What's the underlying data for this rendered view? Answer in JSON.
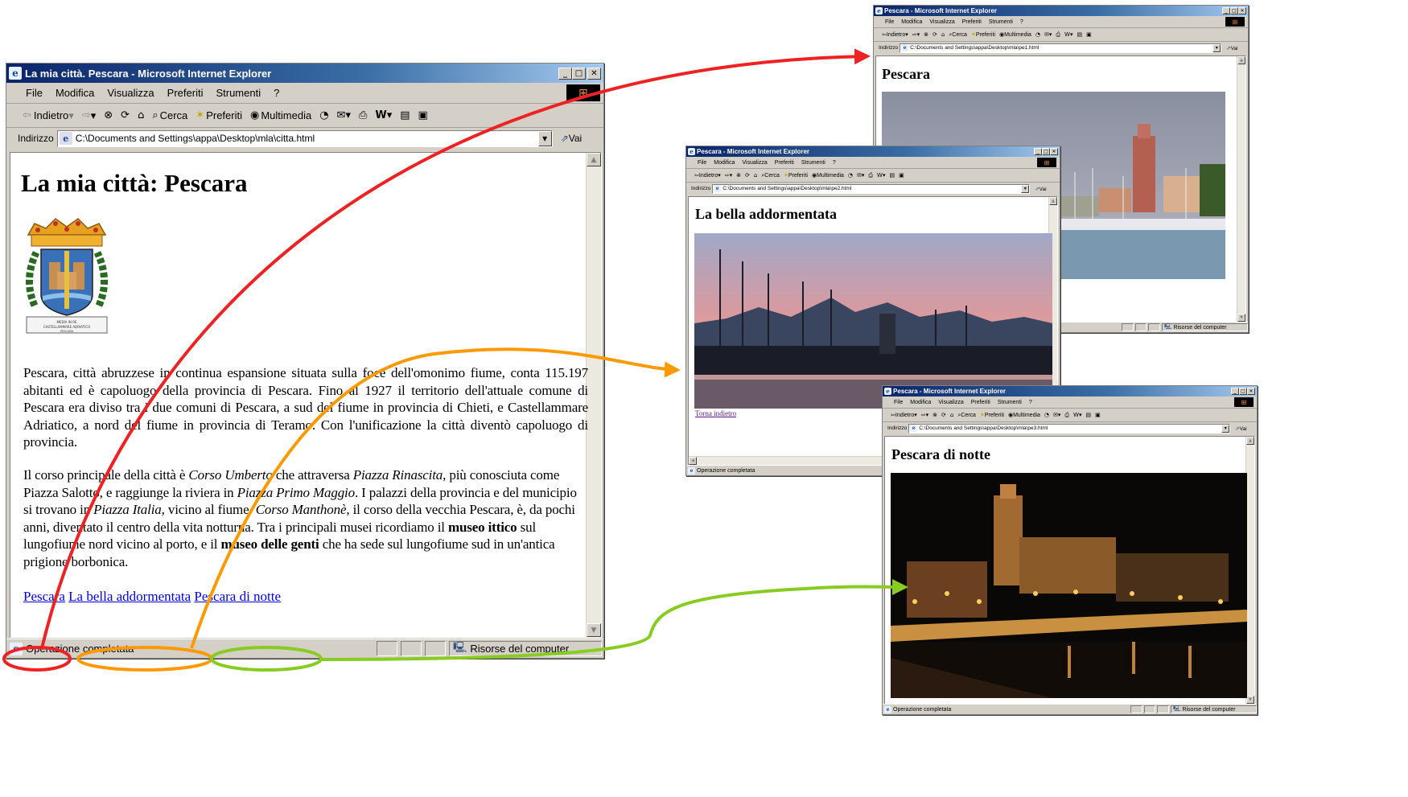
{
  "menu": [
    "File",
    "Modifica",
    "Visualizza",
    "Preferiti",
    "Strumenti",
    "?"
  ],
  "toolbar": {
    "back": "Indietro",
    "search": "Cerca",
    "favorites": "Preferiti",
    "media": "Multimedia"
  },
  "addr_label": "Indirizzo",
  "go_label": "Vai",
  "status_done": "Operazione completata",
  "status_zone": "Risorse del computer",
  "main": {
    "window_title": "La mia città. Pescara - Microsoft Internet Explorer",
    "address": "C:\\Documents and Settings\\appa\\Desktop\\mla\\citta.html",
    "heading": "La mia città: Pescara",
    "p1": "Pescara, città abruzzese in continua espansione situata sulla foce dell'omonimo fiume, conta 115.197 abitanti ed è capoluogo della provincia di Pescara. Fino al 1927 il territorio dell'attuale comune di Pescara era diviso tra i due comuni di Pescara, a sud del fiume in provincia di Chieti, e Castellammare Adriatico, a nord del fiume in provincia di Teramo. Con l'unificazione la città diventò capoluogo di provincia.",
    "p2": {
      "t1": "Il corso principale della città è ",
      "i1": "Corso Umberto",
      "t2": " che attraversa ",
      "i2": "Piazza Rinascita",
      "t3": ", più conosciuta come Piazza Salotto, e raggiunge la riviera in ",
      "i3": "Piazza Primo Maggio",
      "t4": ". I palazzi della provincia e del municipio si trovano in ",
      "i4": "Piazza Italia",
      "t5": ", vicino al fiume. ",
      "i5": "Corso Manthonè",
      "t6": ", il corso della vecchia Pescara, è, da pochi anni, diventato il centro della vita notturna. Tra i principali musei ricordiamo il ",
      "b1": "museo ittico",
      "t7": " sul lungofiume nord vicino al porto, e il ",
      "b2": "museo delle genti",
      "t8": " che ha sede sul lungofiume sud in un'antica prigione borbonica."
    },
    "links": [
      "Pescara",
      "La bella addormentata",
      "Pescara di notte"
    ],
    "crest_motto": [
      "MEDIA IN RE",
      "CASTELLAMMARE ADRIATICO",
      "PESCARA"
    ]
  },
  "win1": {
    "window_title": "Pescara - Microsoft Internet Explorer",
    "address": "C:\\Documents and Settings\\appa\\Desktop\\mla\\pe1.html",
    "heading": "Pescara"
  },
  "win2": {
    "window_title": "Pescara - Microsoft Internet Explorer",
    "address": "C:\\Documents and Settings\\appa\\Desktop\\mla\\pe2.html",
    "heading": "La bella addormentata",
    "back_link": "Torna indietro"
  },
  "win3": {
    "window_title": "Pescara - Microsoft Internet Explorer",
    "address": "C:\\Documents and Settings\\appa\\Desktop\\mla\\pe3.html",
    "heading": "Pescara di notte"
  },
  "colors": {
    "arrow_pe1": "#ee2222",
    "arrow_pe2": "#ff9900",
    "arrow_pe3": "#88cc22",
    "title_bar": "#0a246a",
    "link": "#0000ee"
  }
}
